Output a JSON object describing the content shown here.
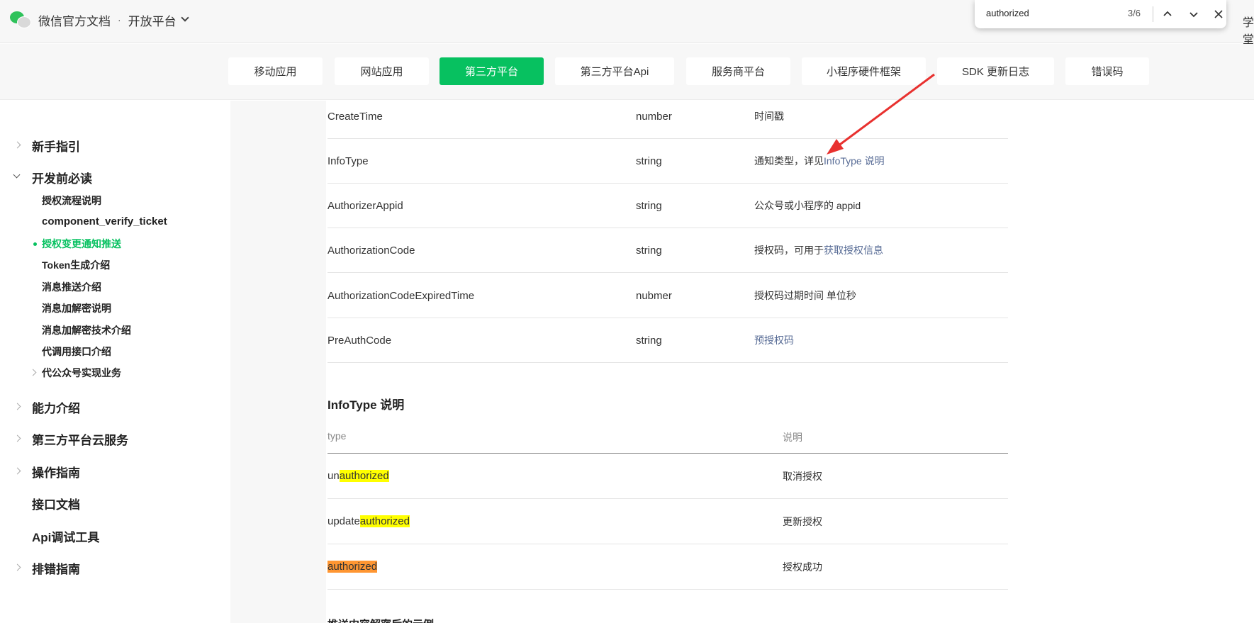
{
  "header": {
    "title": "微信官方文档",
    "separator": "·",
    "platform": "开放平台",
    "corner_text": "学堂"
  },
  "findbar": {
    "query": "authorized",
    "count": "3/6"
  },
  "tabs": [
    {
      "label": "移动应用"
    },
    {
      "label": "网站应用"
    },
    {
      "label": "第三方平台",
      "active": true
    },
    {
      "label": "第三方平台Api"
    },
    {
      "label": "服务商平台"
    },
    {
      "label": "小程序硬件框架"
    },
    {
      "label": "SDK 更新日志"
    },
    {
      "label": "错误码"
    }
  ],
  "sidebar": {
    "top_items": [
      {
        "label": "新手指引"
      },
      {
        "label": "开发前必读",
        "expanded": true
      },
      {
        "label": "能力介绍"
      },
      {
        "label": "第三方平台云服务"
      },
      {
        "label": "操作指南"
      },
      {
        "label": "接口文档"
      },
      {
        "label": "Api调试工具"
      },
      {
        "label": "排错指南"
      }
    ],
    "sub_items": [
      {
        "label": "授权流程说明"
      },
      {
        "label": "component_verify_ticket"
      },
      {
        "label": "授权变更通知推送",
        "active": true
      },
      {
        "label": "Token生成介绍"
      },
      {
        "label": "消息推送介绍"
      },
      {
        "label": "消息加解密说明"
      },
      {
        "label": "消息加解密技术介绍"
      },
      {
        "label": "代调用接口介绍"
      },
      {
        "label": "代公众号实现业务"
      }
    ]
  },
  "params": [
    {
      "name": "CreateTime",
      "type": "number",
      "desc": "时间戳"
    },
    {
      "name": "InfoType",
      "type": "string",
      "desc": "通知类型，详见",
      "link": "InfoType 说明"
    },
    {
      "name": "AuthorizerAppid",
      "type": "string",
      "desc": "公众号或小程序的 appid"
    },
    {
      "name": "AuthorizationCode",
      "type": "string",
      "desc": "授权码，可用于",
      "link": "获取授权信息"
    },
    {
      "name": "AuthorizationCodeExpiredTime",
      "type": "nubmer",
      "desc": "授权码过期时间 单位秒"
    },
    {
      "name": "PreAuthCode",
      "type": "string",
      "desc": "",
      "link": "预授权码"
    }
  ],
  "infotype": {
    "title": "InfoType 说明",
    "col_type": "type",
    "col_desc": "说明",
    "rows": [
      {
        "prefix": "un",
        "match": "authorized",
        "desc": "取消授权"
      },
      {
        "prefix": "update",
        "match": "authorized",
        "desc": "更新授权"
      },
      {
        "prefix": "",
        "match": "authorized",
        "desc": "授权成功",
        "current": true
      }
    ]
  },
  "next_section_title": "推送内容解密后的示例"
}
